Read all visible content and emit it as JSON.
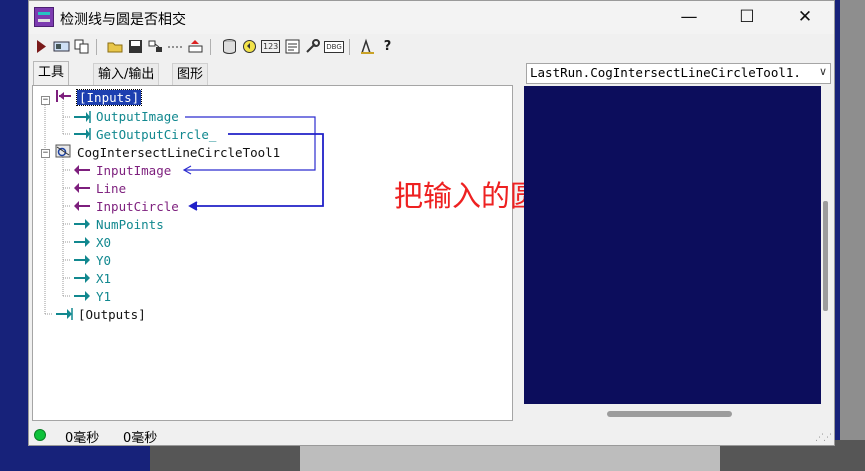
{
  "window": {
    "title": "检测线与圆是否相交"
  },
  "window_controls": {
    "minimize": "—",
    "maximize": "☐",
    "close": "✕"
  },
  "toolbar": {
    "icons": [
      "run-icon",
      "image-icon",
      "copy-icon",
      "open-folder-icon",
      "save-icon",
      "link-icon",
      "dotted-line-icon",
      "sort-icon",
      "database-icon",
      "refresh-icon",
      "numbers-icon",
      "list-icon",
      "wrench-icon",
      "debug-icon",
      "measure-icon",
      "help-icon"
    ],
    "label_123": "123",
    "label_dbg": "DBG"
  },
  "tabs": [
    {
      "label": "工具"
    },
    {
      "label": "输入/输出"
    },
    {
      "label": "图形"
    }
  ],
  "tree": {
    "inputs_label": "[Inputs]",
    "output_image": "OutputImage",
    "get_output_circle": "GetOutputCircle_",
    "tool_name": "CogIntersectLineCircleTool1",
    "params": [
      "InputImage",
      "Line",
      "InputCircle",
      "NumPoints",
      "X0",
      "Y0",
      "X1",
      "Y1"
    ],
    "outputs_label": "[Outputs]",
    "expander_minus": "−"
  },
  "annotation": "把输入的圆,再出入给检测工具",
  "display": {
    "selector_value": "LastRun.CogIntersectLineCircleTool1.",
    "selector_arrow": "∨"
  },
  "status": {
    "time1": "0毫秒",
    "time2": "0毫秒",
    "grip": "⋰⋰"
  },
  "colors": {
    "teal": "#11888f",
    "purple": "#7d1f7d",
    "link_blue": "#2c2ccf",
    "annotation_red": "#ee2121",
    "display_bg": "#0c0d5c"
  }
}
